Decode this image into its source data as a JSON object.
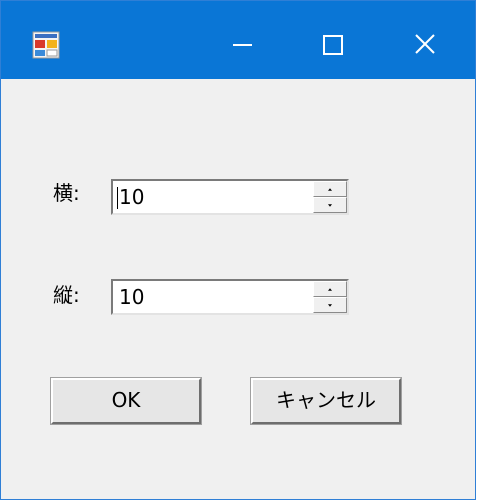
{
  "window": {
    "controls": {
      "minimize": "minimize",
      "maximize": "maximize",
      "close": "close"
    },
    "icon": "app-form-icon"
  },
  "form": {
    "width_label": "横:",
    "width_value": "10",
    "height_label": "縦:",
    "height_value": "10"
  },
  "buttons": {
    "ok_label": "OK",
    "cancel_label": "キャンセル"
  },
  "colors": {
    "titlebar": "#0a76d6",
    "background": "#f0f0f0"
  }
}
